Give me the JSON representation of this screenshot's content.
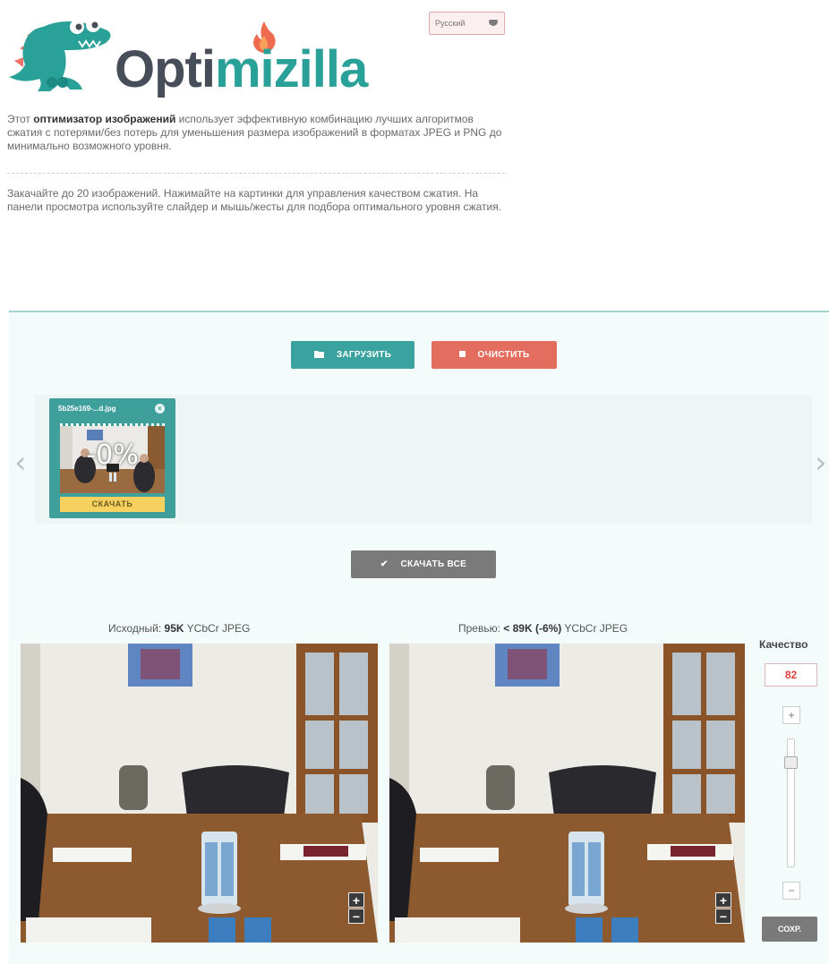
{
  "header": {
    "logo_text_part1": "Opti",
    "logo_text_part2": "mizilla",
    "language": "Русский"
  },
  "intro": {
    "p1_before": "Этот ",
    "p1_bold": "оптимизатор изображений",
    "p1_after": " использует эффективную комбинацию лучших алгоритмов сжатия с потерями/без потерь для уменьшения размера изображений в форматах JPEG и PNG до минимально возможного уровня.",
    "p2": "Закачайте до 20 изображений. Нажимайте на картинки для управления качеством сжатия. На панели просмотра используйте слайдер и мышь/жесты для подбора оптимального уровня сжатия."
  },
  "toolbar": {
    "upload_label": "ЗАГРУЗИТЬ",
    "clear_label": "ОЧИСТИТЬ",
    "download_all_label": "СКАЧАТЬ ВСЕ"
  },
  "thumbnails": [
    {
      "filename": "5b25e169-...d.jpg",
      "savings": "-0%",
      "download_label": "СКАЧАТЬ"
    }
  ],
  "compare": {
    "original_prefix": "Исходный: ",
    "original_size": "95K",
    "original_suffix": " YCbCr JPEG",
    "preview_prefix": "Превью: ",
    "preview_size": "< 89K (-6%)",
    "preview_suffix": " YCbCr JPEG"
  },
  "quality": {
    "label": "Качество",
    "value": "82",
    "plus": "+",
    "minus": "−",
    "save_label": "СОХР."
  },
  "colors": {
    "brand_teal": "#3aa3a0",
    "brand_dark": "#474e59",
    "clear_red": "#e36d5f",
    "download_yellow": "#f6d15f"
  }
}
